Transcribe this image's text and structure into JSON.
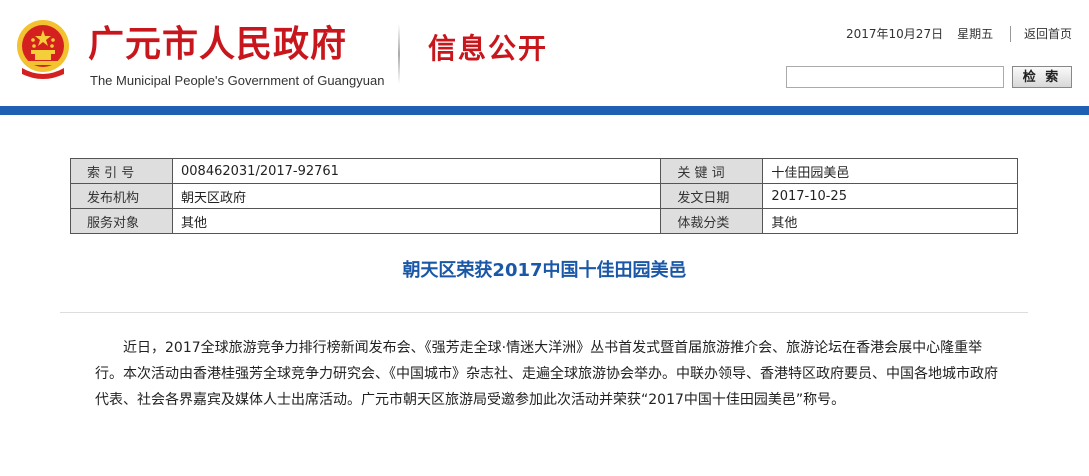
{
  "header": {
    "site_title_cn": "广元市人民政府",
    "site_title_en": "The Municipal People's Government of Guangyuan",
    "section_title": "信息公开",
    "date": "2017年10月27日",
    "weekday": "星期五",
    "home_link": "返回首页",
    "search_button": "检 索",
    "search_value": ""
  },
  "meta": {
    "rows": [
      [
        {
          "label": "索 引 号",
          "value": "008462031/2017-92761"
        },
        {
          "label": "关 键 词",
          "value": "十佳田园美邑"
        }
      ],
      [
        {
          "label": "发布机构",
          "value": "朝天区政府"
        },
        {
          "label": "发文日期",
          "value": "2017-10-25"
        }
      ],
      [
        {
          "label": "服务对象",
          "value": "其他"
        },
        {
          "label": "体裁分类",
          "value": "其他"
        }
      ]
    ]
  },
  "article": {
    "title": "朝天区荣获2017中国十佳田园美邑",
    "body": "近日，2017全球旅游竞争力排行榜新闻发布会、《强芳走全球·情迷大洋洲》丛书首发式暨首届旅游推介会、旅游论坛在香港会展中心隆重举行。本次活动由香港桂强芳全球竞争力研究会、《中国城市》杂志社、走遍全球旅游协会举办。中联办领导、香港特区政府要员、中国各地城市政府代表、社会各界嘉宾及媒体人士出席活动。广元市朝天区旅游局受邀参加此次活动并荣获“2017中国十佳田园美邑”称号。"
  },
  "colors": {
    "title_red": "#c8161d",
    "band_blue": "#1f5fb4",
    "article_title_blue": "#1a57a6",
    "label_bg": "#dedede"
  },
  "icons": {
    "emblem": "national-emblem-icon"
  }
}
